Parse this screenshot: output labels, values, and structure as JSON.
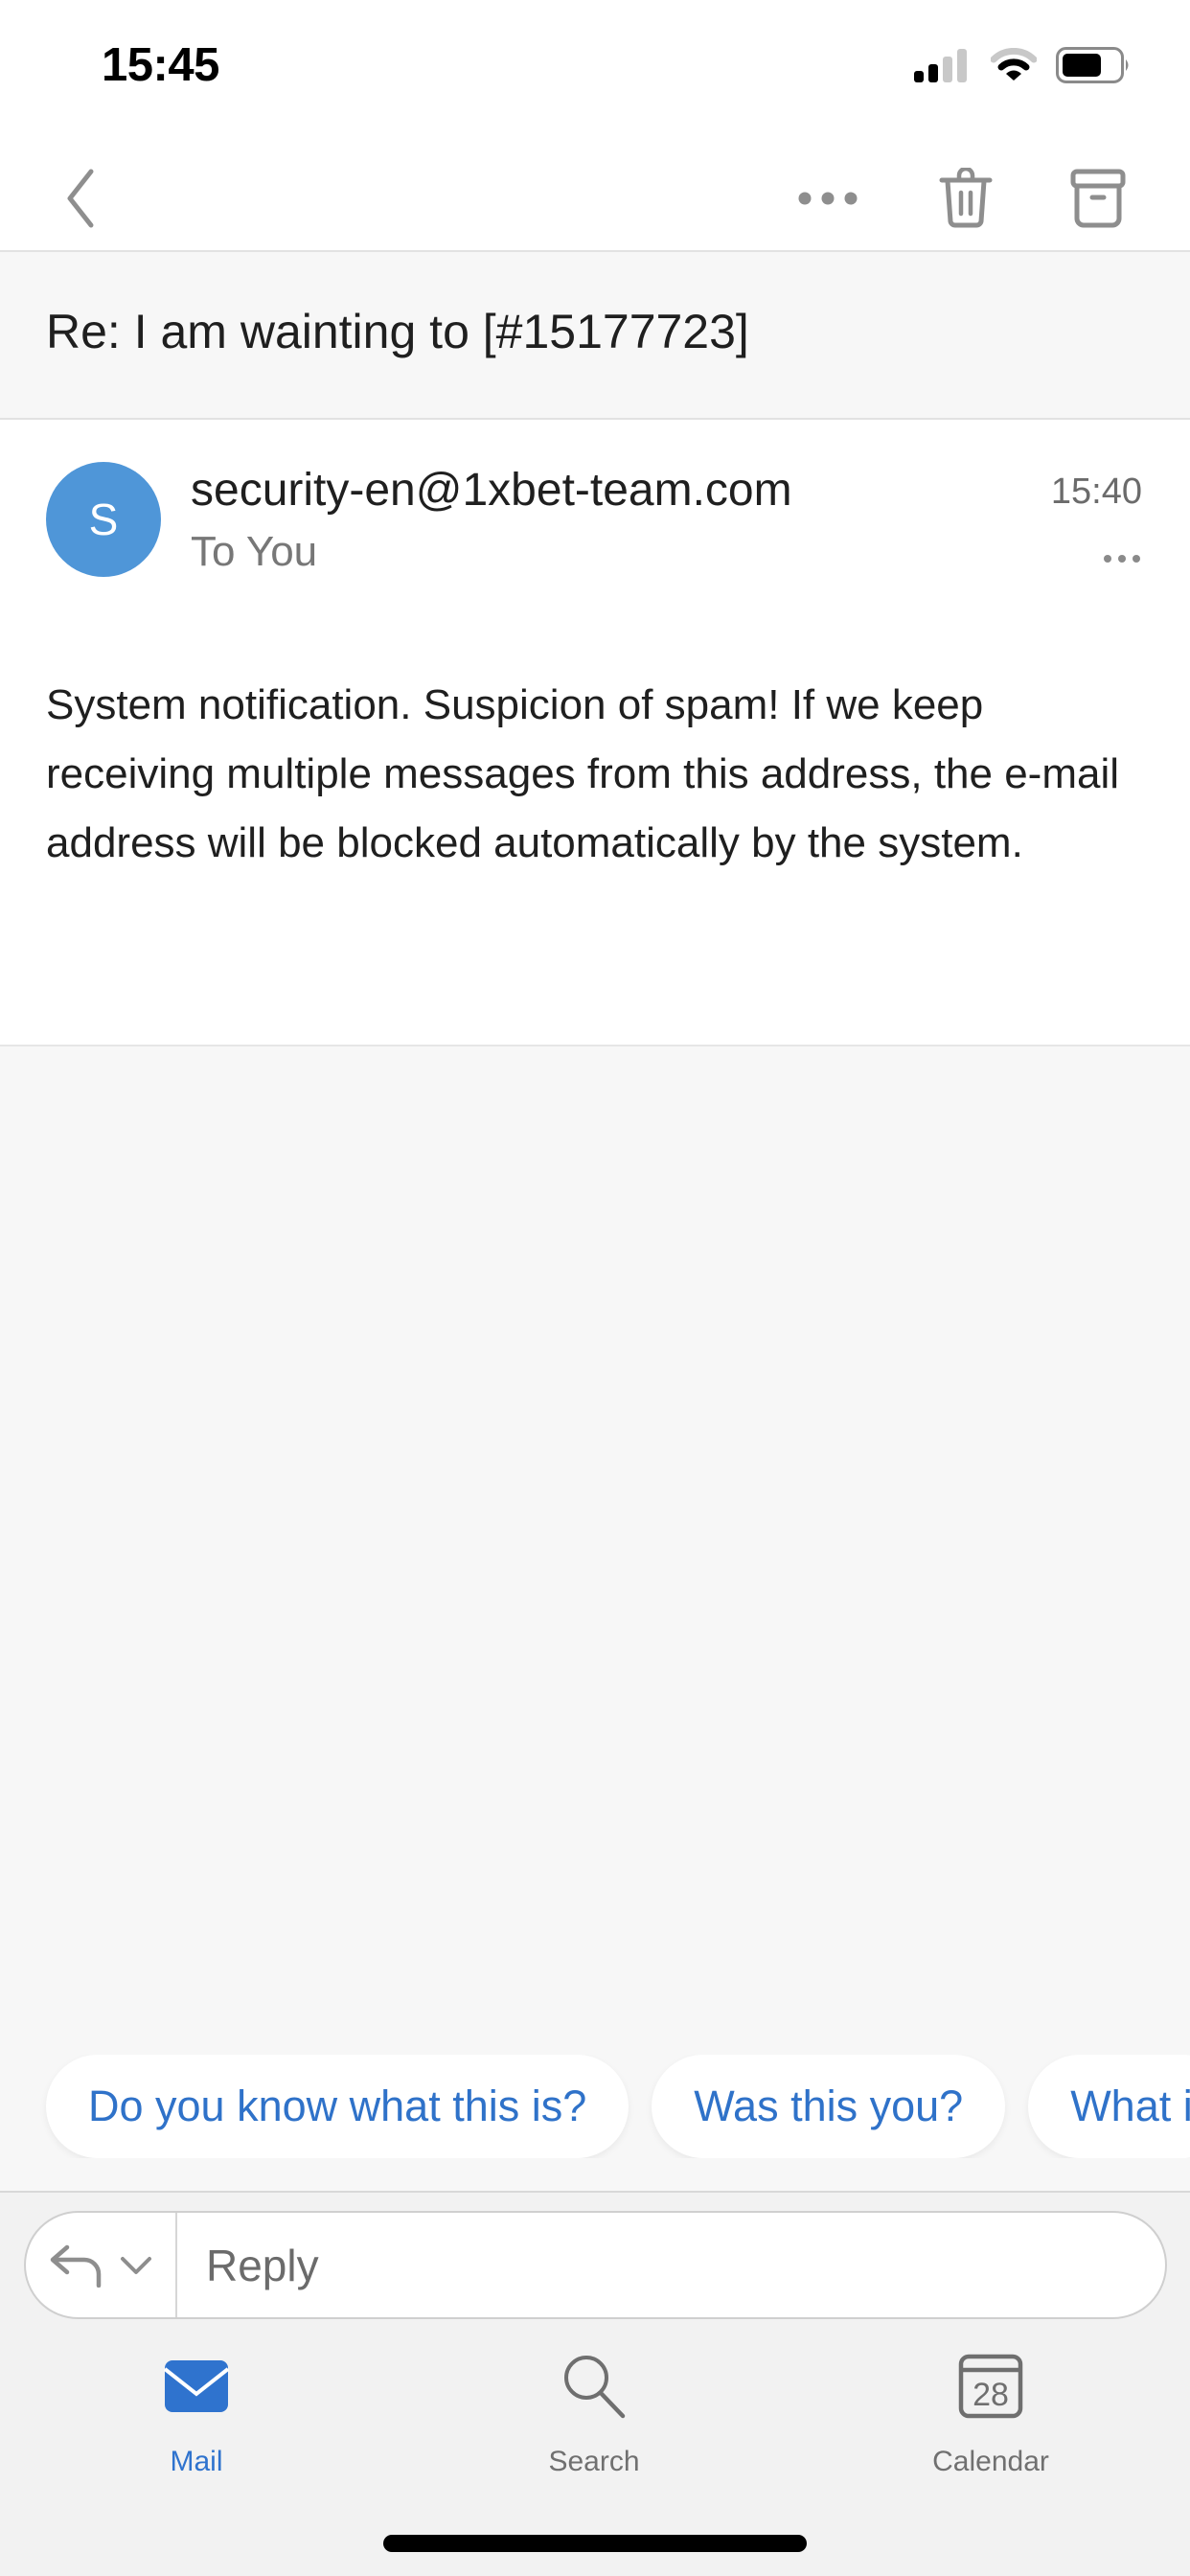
{
  "status_bar": {
    "time": "15:45",
    "signal_bars_active": 2,
    "signal_bars_total": 4,
    "wifi_level": 2,
    "wifi_level_max": 3,
    "battery_level": 0.7
  },
  "nav": {
    "back_icon": "chevron-left-icon",
    "more_icon": "ellipsis-icon",
    "delete_icon": "trash-icon",
    "archive_icon": "archive-box-icon"
  },
  "message": {
    "subject": "Re: I am wainting to [#15177723]",
    "avatar_initial": "S",
    "sender": "security-en@1xbet-team.com",
    "recipient": "To You",
    "time": "15:40",
    "body": "System notification. Suspicion of spam! If we keep receiving multiple messages from this address, the e-mail address will be blocked automatically by the system."
  },
  "suggestions": [
    {
      "label": "Do you know what this is?"
    },
    {
      "label": "Was this you?"
    },
    {
      "label": "What i"
    }
  ],
  "reply": {
    "placeholder": "Reply",
    "reply_icon": "reply-arrow-icon",
    "dropdown_icon": "chevron-down-icon"
  },
  "tabs": [
    {
      "label": "Mail",
      "icon": "mail-icon",
      "active": true
    },
    {
      "label": "Search",
      "icon": "search-icon",
      "active": false
    },
    {
      "label": "Calendar",
      "icon": "calendar-icon",
      "active": false,
      "badge_text": "28"
    }
  ],
  "colors": {
    "accent": "#2f73ce",
    "link": "#2f72c9",
    "avatar": "#4f96d8",
    "icon_gray": "#8e8e8e"
  }
}
